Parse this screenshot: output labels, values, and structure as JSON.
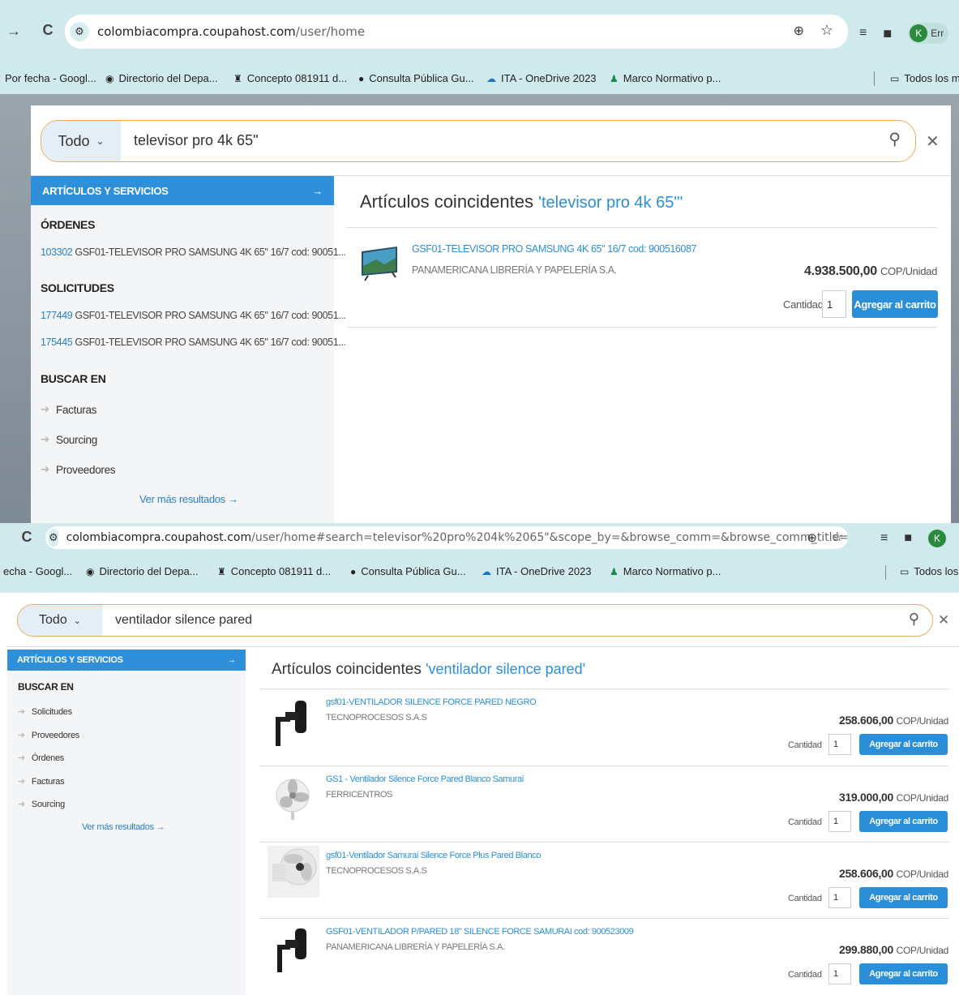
{
  "top": {
    "browser": {
      "url_host": "colombiacompra.coupahost.com",
      "url_path": "/user/home",
      "profile_initial": "K",
      "profile_label": "Err"
    },
    "bookmarks": [
      {
        "label": "Por fecha - Googl...",
        "icon": "none"
      },
      {
        "label": "Directorio del Depa...",
        "icon": "seal-icon"
      },
      {
        "label": "Concepto 081911 d...",
        "icon": "crest-icon"
      },
      {
        "label": "Consulta Pública Gu...",
        "icon": "globe-icon"
      },
      {
        "label": "ITA - OneDrive 2023",
        "icon": "cloud-icon"
      },
      {
        "label": "Marco Normativo p...",
        "icon": "scales-icon"
      }
    ],
    "all_bookmarks": "Todos los m",
    "search": {
      "scope": "Todo",
      "query": "televisor pro 4k 65\""
    },
    "left": {
      "header": "ARTÍCULOS Y SERVICIOS",
      "ordenes_title": "ÓRDENES",
      "ordenes": [
        {
          "num": "103302",
          "text": "GSF01-TELEVISOR PRO SAMSUNG 4K 65\" 16/7 cod: 90051..."
        }
      ],
      "solicitudes_title": "SOLICITUDES",
      "solicitudes": [
        {
          "num": "177449",
          "text": "GSF01-TELEVISOR PRO SAMSUNG 4K 65\" 16/7 cod: 90051..."
        },
        {
          "num": "175445",
          "text": "GSF01-TELEVISOR PRO SAMSUNG 4K 65\" 16/7 cod: 90051..."
        }
      ],
      "buscar_title": "BUSCAR EN",
      "buscar_en": [
        "Facturas",
        "Sourcing",
        "Proveedores"
      ],
      "more": "Ver más resultados →"
    },
    "results": {
      "title": "Artículos coincidentes",
      "query_label": "'televisor pro 4k 65\"'",
      "items": [
        {
          "name": "GSF01-TELEVISOR PRO SAMSUNG 4K 65\" 16/7 cod: 900516087",
          "supplier": "PANAMERICANA LIBRERÍA Y PAPELERÍA S.A.",
          "price": "4.938.500,00",
          "unit": "COP/Unidad",
          "qty_label": "Cantidad",
          "qty": "1",
          "button": "Agregar al carrito"
        }
      ]
    }
  },
  "bottom": {
    "browser": {
      "url_host": "colombiacompra.coupahost.com",
      "url_path": "/user/home#search=televisor%20pro%204k%2065\"&scope_by=&browse_comm=&browse_comm_title=",
      "profile_initial": "K"
    },
    "bookmarks": [
      {
        "label": "echa - Googl...",
        "icon": "none"
      },
      {
        "label": "Directorio del Depa...",
        "icon": "seal-icon"
      },
      {
        "label": "Concepto 081911 d...",
        "icon": "crest-icon"
      },
      {
        "label": "Consulta Pública Gu...",
        "icon": "globe-icon"
      },
      {
        "label": "ITA - OneDrive 2023",
        "icon": "cloud-icon"
      },
      {
        "label": "Marco Normativo p...",
        "icon": "scales-icon"
      }
    ],
    "all_bookmarks": "Todos los",
    "search": {
      "scope": "Todo",
      "query": "ventilador silence pared"
    },
    "left": {
      "header": "ARTÍCULOS Y SERVICIOS",
      "buscar_title": "BUSCAR EN",
      "buscar_en": [
        "Solicitudes",
        "Proveedores",
        "Órdenes",
        "Facturas",
        "Sourcing"
      ],
      "more": "Ver más resultados →"
    },
    "results": {
      "title": "Artículos coincidentes",
      "query_label": "'ventilador silence pared'",
      "items": [
        {
          "name": "gsf01-VENTILADOR SILENCE FORCE PARED NEGRO",
          "supplier": "TECNOPROCESOS S.A.S",
          "price": "258.606,00",
          "unit": "COP/Unidad",
          "qty_label": "Cantidad",
          "qty": "1",
          "button": "Agregar al carrito"
        },
        {
          "name": "GS1 - Ventilador Silence Force Pared Blanco Samurai",
          "supplier": "FERRICENTROS",
          "price": "319.000,00",
          "unit": "COP/Unidad",
          "qty_label": "Cantidad",
          "qty": "1",
          "button": "Agregar al carrito"
        },
        {
          "name": "gsf01-Ventilador Samurai Silence Force Plus Pared Blanco",
          "supplier": "TECNOPROCESOS S.A.S",
          "price": "258.606,00",
          "unit": "COP/Unidad",
          "qty_label": "Cantidad",
          "qty": "1",
          "button": "Agregar al carrito"
        },
        {
          "name": "GSF01-VENTILADOR P/PARED 18\" SILENCE FORCE SAMURAI cod: 900523009",
          "supplier": "PANAMERICANA LIBRERÍA Y PAPELERÍA S.A.",
          "price": "299.880,00",
          "unit": "COP/Unidad",
          "qty_label": "Cantidad",
          "qty": "1",
          "button": "Agregar al carrito"
        }
      ]
    }
  }
}
